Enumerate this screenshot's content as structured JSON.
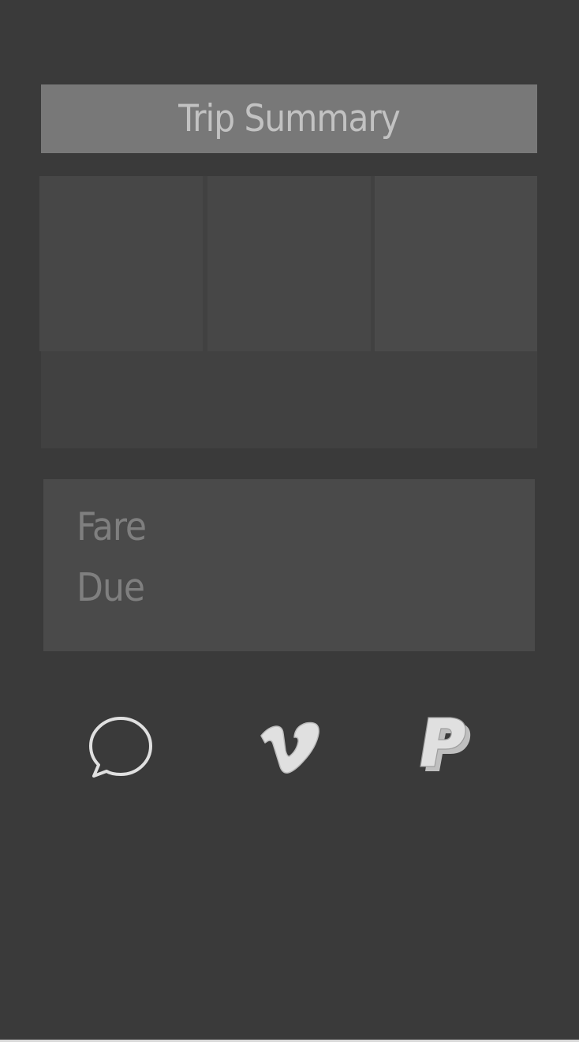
{
  "header": {
    "title": "Trip Summary"
  },
  "fare": {
    "line1": "Fare",
    "line2": "Due"
  },
  "actions": [
    {
      "icon": "message-bubble-icon"
    },
    {
      "icon": "vimeo-icon"
    },
    {
      "icon": "paypal-icon"
    }
  ],
  "colors": {
    "background": "#3a3a3a",
    "header_bg": "#787878",
    "header_text": "#c2c2c2",
    "card_bg": "#414141",
    "tile_bg": "#474747",
    "fare_bg": "#4a4a4a",
    "fare_text": "#7f7f7f",
    "icon": "#e0e0e0"
  }
}
